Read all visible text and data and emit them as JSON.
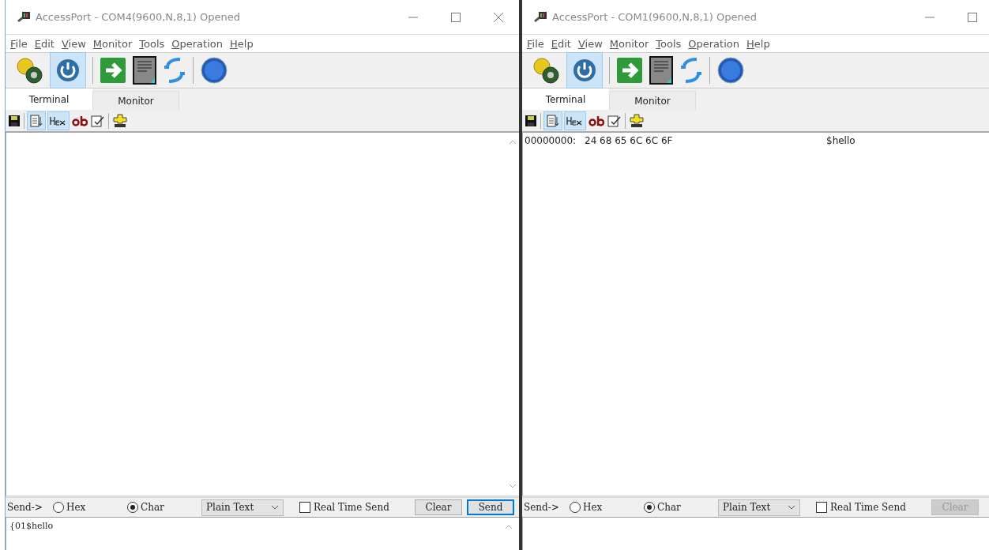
{
  "windows": [
    {
      "title": "AccessPort - COM4(9600,N,8,1) Opened",
      "menu": [
        "File",
        "Edit",
        "View",
        "Monitor",
        "Tools",
        "Operation",
        "Help"
      ],
      "tabs": [
        {
          "label": "Terminal",
          "selected": true
        },
        {
          "label": "Monitor",
          "selected": false
        }
      ],
      "view_toggles": [
        {
          "kind": "list",
          "on": true
        },
        {
          "kind": "hex",
          "on": true
        }
      ],
      "send_bar": {
        "label": "Send->",
        "radios": [
          {
            "label": "Hex",
            "selected": false
          },
          {
            "label": "Char",
            "selected": true
          }
        ],
        "format": "Plain Text",
        "realtime": {
          "label": "Real Time Send",
          "checked": false
        },
        "buttons": [
          {
            "label": "Clear",
            "disabled": false,
            "kind": "plain"
          },
          {
            "label": "Send",
            "disabled": false,
            "kind": "default"
          }
        ]
      },
      "input": "{01$hello"
    },
    {
      "title": "AccessPort - COM1(9600,N,8,1) Opened",
      "menu": [
        "File",
        "Edit",
        "View",
        "Monitor",
        "Tools",
        "Operation",
        "Help"
      ],
      "tabs": [
        {
          "label": "Terminal",
          "selected": true
        },
        {
          "label": "Monitor",
          "selected": false
        }
      ],
      "view_toggles": [
        {
          "kind": "list",
          "on": true
        },
        {
          "kind": "hex",
          "on": true
        }
      ],
      "terminal_lines": [
        {
          "offset": "00000000:",
          "hex": "24 68 65 6C 6C 6F",
          "ascii": "$hello"
        }
      ],
      "send_bar": {
        "label": "Send->",
        "radios": [
          {
            "label": "Hex",
            "selected": false
          },
          {
            "label": "Char",
            "selected": true
          }
        ],
        "format": "Plain Text",
        "realtime": {
          "label": "Real Time Send",
          "checked": false
        },
        "buttons": [
          {
            "label": "Clear",
            "disabled": true,
            "kind": "plain"
          }
        ]
      }
    }
  ]
}
